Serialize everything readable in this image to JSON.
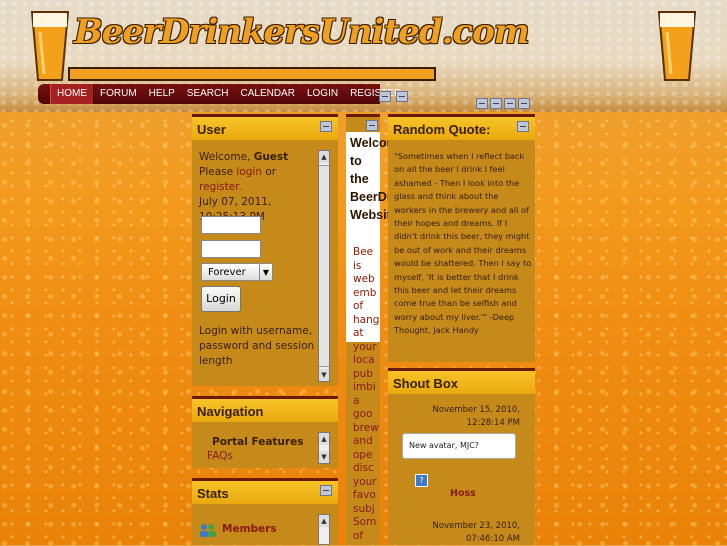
{
  "header": {
    "logo_text": "BeerDrinkersUnited.com",
    "nav": [
      "HOME",
      "FORUM",
      "HELP",
      "SEARCH",
      "CALENDAR",
      "LOGIN",
      "REGISTER"
    ]
  },
  "user_panel": {
    "title": "User",
    "welcome_prefix": "Welcome,",
    "welcome_name": "Guest",
    "please": "Please",
    "login_link": "login",
    "or": "or",
    "register_link": "register.",
    "datetime": "July 07, 2011, 10:25:13 PM",
    "select_value": "Forever",
    "login_button": "Login",
    "hint": "Login with username, password and session length"
  },
  "navigation_panel": {
    "title": "Navigation",
    "items": [
      "Portal Features",
      "FAQs"
    ]
  },
  "stats_panel": {
    "title": "Stats",
    "members_label": "Members"
  },
  "welcome_panel": {
    "title": "Welcome to the BeerDrinkersUnited.com Website!",
    "body_words": [
      "Bee",
      "is",
      "web",
      "emb",
      "of",
      "hang",
      "at",
      "your",
      "loca",
      "pub",
      "imbi",
      "a",
      "goo",
      "brew",
      "and",
      "ope",
      "disc",
      "your",
      "favo",
      "subj",
      "Som",
      "of"
    ]
  },
  "quote_panel": {
    "title": "Random Quote:",
    "text": "\"Sometimes when I reflect back on all the beer I drink I feel ashamed - Then I look into the glass and think about the workers in the brewery and all of their hopes and dreams. If I didn't drink this beer, they might be out of work and their dreams would be shattered. Then I say to myself, 'It is better that I drink this beer and let their dreams come true than be selfish and worry about my liver.'\" -Deep Thought, Jack Handy"
  },
  "shoutbox": {
    "title": "Shout Box",
    "entries": [
      {
        "date": "November 15, 2010,",
        "time": "12:28:14 PM",
        "message": "New avatar, MJC?",
        "author": "Hoss"
      },
      {
        "date": "November 23, 2010,",
        "time": "07:46:10 AM"
      }
    ]
  },
  "colors": {
    "accent": "#f0a020",
    "nav_bg": "#6a0a0a",
    "panel_bg": "#c58a1a"
  }
}
